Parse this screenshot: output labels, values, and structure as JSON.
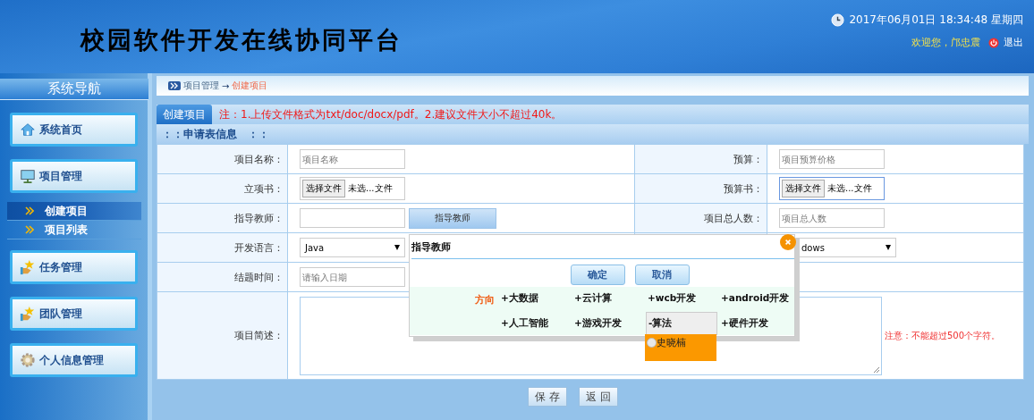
{
  "header": {
    "title": "校园软件开发在线协同平台",
    "datetime": "2017年06月01日 18:34:48 星期四",
    "welcome": "欢迎您，邝忠震",
    "logout": "退出"
  },
  "sidebar": {
    "title": "系统导航",
    "items": [
      {
        "label": "系统首页"
      },
      {
        "label": "项目管理",
        "children": [
          {
            "label": "创建项目",
            "selected": true
          },
          {
            "label": "项目列表",
            "selected": false
          }
        ]
      },
      {
        "label": "任务管理"
      },
      {
        "label": "团队管理"
      },
      {
        "label": "个人信息管理"
      }
    ]
  },
  "breadcrumb": {
    "parent": "项目管理",
    "arrow": "→",
    "current": "创建项目"
  },
  "tab": {
    "label": "创建项目",
    "note": "注：1.上传文件格式为txt/doc/docx/pdf。2.建议文件大小不超过40k。"
  },
  "section_title": "：：申请表信息　：：",
  "rows": [
    {
      "label": "项目名称：",
      "field": {
        "kind": "text",
        "placeholder": "项目名称"
      },
      "right": {
        "label": "预算：",
        "field": {
          "kind": "text",
          "placeholder": "项目预算价格"
        }
      }
    },
    {
      "label": "立项书：",
      "field": {
        "kind": "file",
        "button": "选择文件",
        "value": "未选...文件",
        "focused": false
      },
      "right": {
        "label": "预算书：",
        "field": {
          "kind": "file",
          "button": "选择文件",
          "value": "未选...文件",
          "focused": true
        }
      }
    },
    {
      "label": "指导教师：",
      "field": {
        "kind": "picker",
        "button": "指导教师"
      },
      "right": {
        "label": "项目总人数：",
        "field": {
          "kind": "text",
          "placeholder": "项目总人数"
        }
      }
    },
    {
      "label": "开发语言：",
      "field": {
        "kind": "select",
        "value": "Java"
      },
      "right": {
        "field": {
          "kind": "select",
          "value": "dows"
        }
      }
    },
    {
      "label": "结题时间：",
      "field": {
        "kind": "text",
        "placeholder": "请输入日期"
      },
      "right": {}
    },
    {
      "label": "项目简述：",
      "field": {
        "kind": "textarea"
      },
      "note": "注意：不能超过500个字符。"
    }
  ],
  "actions": [
    "保 存",
    "返 回"
  ],
  "dialog": {
    "title": "指导教师",
    "buttons": [
      "确定",
      "取消"
    ],
    "direction_label": "方向",
    "categories": [
      {
        "label": "+大数据",
        "expanded": false
      },
      {
        "label": "+云计算",
        "expanded": false
      },
      {
        "label": "+wcb开发",
        "expanded": false
      },
      {
        "label": "+android开发",
        "expanded": false
      },
      {
        "label": "+人工智能",
        "expanded": false
      },
      {
        "label": "+游戏开发",
        "expanded": false
      },
      {
        "label": "-算法",
        "expanded": true,
        "teachers": [
          {
            "name": "史晓楠",
            "selected": false
          }
        ]
      },
      {
        "label": "+硬件开发",
        "expanded": false
      }
    ]
  }
}
